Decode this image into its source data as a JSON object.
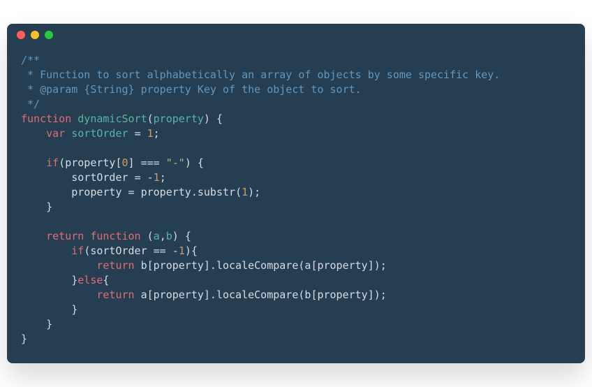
{
  "window": {
    "dots": [
      "red",
      "yellow",
      "green"
    ]
  },
  "code": {
    "tokens": [
      {
        "cls": "tok-comment",
        "text": "/**"
      },
      {
        "cls": "",
        "text": "\n"
      },
      {
        "cls": "tok-comment",
        "text": " * Function to sort alphabetically an array of objects by some specific key."
      },
      {
        "cls": "",
        "text": "\n"
      },
      {
        "cls": "tok-comment",
        "text": " * @param {String} property Key of the object to sort."
      },
      {
        "cls": "",
        "text": "\n"
      },
      {
        "cls": "tok-comment",
        "text": " */"
      },
      {
        "cls": "",
        "text": "\n"
      },
      {
        "cls": "tok-keyword",
        "text": "function"
      },
      {
        "cls": "",
        "text": " "
      },
      {
        "cls": "tok-funcname",
        "text": "dynamicSort"
      },
      {
        "cls": "tok-punct",
        "text": "("
      },
      {
        "cls": "tok-param",
        "text": "property"
      },
      {
        "cls": "tok-punct",
        "text": ")"
      },
      {
        "cls": "",
        "text": " "
      },
      {
        "cls": "tok-punct",
        "text": "{"
      },
      {
        "cls": "",
        "text": "\n    "
      },
      {
        "cls": "tok-keyword",
        "text": "var"
      },
      {
        "cls": "",
        "text": " "
      },
      {
        "cls": "tok-var",
        "text": "sortOrder"
      },
      {
        "cls": "",
        "text": " "
      },
      {
        "cls": "tok-op",
        "text": "="
      },
      {
        "cls": "",
        "text": " "
      },
      {
        "cls": "tok-num",
        "text": "1"
      },
      {
        "cls": "tok-punct",
        "text": ";"
      },
      {
        "cls": "",
        "text": "\n\n    "
      },
      {
        "cls": "tok-keyword",
        "text": "if"
      },
      {
        "cls": "tok-punct",
        "text": "("
      },
      {
        "cls": "tok-ident",
        "text": "property"
      },
      {
        "cls": "tok-punct",
        "text": "["
      },
      {
        "cls": "tok-num",
        "text": "0"
      },
      {
        "cls": "tok-punct",
        "text": "]"
      },
      {
        "cls": "",
        "text": " "
      },
      {
        "cls": "tok-op",
        "text": "==="
      },
      {
        "cls": "",
        "text": " "
      },
      {
        "cls": "tok-str",
        "text": "\"-\""
      },
      {
        "cls": "tok-punct",
        "text": ")"
      },
      {
        "cls": "",
        "text": " "
      },
      {
        "cls": "tok-punct",
        "text": "{"
      },
      {
        "cls": "",
        "text": "\n        "
      },
      {
        "cls": "tok-ident",
        "text": "sortOrder"
      },
      {
        "cls": "",
        "text": " "
      },
      {
        "cls": "tok-op",
        "text": "="
      },
      {
        "cls": "",
        "text": " "
      },
      {
        "cls": "tok-op",
        "text": "-"
      },
      {
        "cls": "tok-num",
        "text": "1"
      },
      {
        "cls": "tok-punct",
        "text": ";"
      },
      {
        "cls": "",
        "text": "\n        "
      },
      {
        "cls": "tok-ident",
        "text": "property"
      },
      {
        "cls": "",
        "text": " "
      },
      {
        "cls": "tok-op",
        "text": "="
      },
      {
        "cls": "",
        "text": " "
      },
      {
        "cls": "tok-ident",
        "text": "property"
      },
      {
        "cls": "tok-punct",
        "text": "."
      },
      {
        "cls": "tok-method",
        "text": "substr"
      },
      {
        "cls": "tok-punct",
        "text": "("
      },
      {
        "cls": "tok-num",
        "text": "1"
      },
      {
        "cls": "tok-punct",
        "text": ");"
      },
      {
        "cls": "",
        "text": "\n    "
      },
      {
        "cls": "tok-punct",
        "text": "}"
      },
      {
        "cls": "",
        "text": "\n\n    "
      },
      {
        "cls": "tok-keyword",
        "text": "return"
      },
      {
        "cls": "",
        "text": " "
      },
      {
        "cls": "tok-keyword",
        "text": "function"
      },
      {
        "cls": "",
        "text": " "
      },
      {
        "cls": "tok-punct",
        "text": "("
      },
      {
        "cls": "tok-param",
        "text": "a"
      },
      {
        "cls": "tok-punct",
        "text": ","
      },
      {
        "cls": "tok-param",
        "text": "b"
      },
      {
        "cls": "tok-punct",
        "text": ")"
      },
      {
        "cls": "",
        "text": " "
      },
      {
        "cls": "tok-punct",
        "text": "{"
      },
      {
        "cls": "",
        "text": "\n        "
      },
      {
        "cls": "tok-keyword",
        "text": "if"
      },
      {
        "cls": "tok-punct",
        "text": "("
      },
      {
        "cls": "tok-ident",
        "text": "sortOrder"
      },
      {
        "cls": "",
        "text": " "
      },
      {
        "cls": "tok-op",
        "text": "=="
      },
      {
        "cls": "",
        "text": " "
      },
      {
        "cls": "tok-op",
        "text": "-"
      },
      {
        "cls": "tok-num",
        "text": "1"
      },
      {
        "cls": "tok-punct",
        "text": "){"
      },
      {
        "cls": "",
        "text": "\n            "
      },
      {
        "cls": "tok-keyword",
        "text": "return"
      },
      {
        "cls": "",
        "text": " "
      },
      {
        "cls": "tok-ident",
        "text": "b"
      },
      {
        "cls": "tok-punct",
        "text": "["
      },
      {
        "cls": "tok-ident",
        "text": "property"
      },
      {
        "cls": "tok-punct",
        "text": "]."
      },
      {
        "cls": "tok-method",
        "text": "localeCompare"
      },
      {
        "cls": "tok-punct",
        "text": "("
      },
      {
        "cls": "tok-ident",
        "text": "a"
      },
      {
        "cls": "tok-punct",
        "text": "["
      },
      {
        "cls": "tok-ident",
        "text": "property"
      },
      {
        "cls": "tok-punct",
        "text": "]);"
      },
      {
        "cls": "",
        "text": "\n        "
      },
      {
        "cls": "tok-punct",
        "text": "}"
      },
      {
        "cls": "tok-keyword",
        "text": "else"
      },
      {
        "cls": "tok-punct",
        "text": "{"
      },
      {
        "cls": "",
        "text": "\n            "
      },
      {
        "cls": "tok-keyword",
        "text": "return"
      },
      {
        "cls": "",
        "text": " "
      },
      {
        "cls": "tok-ident",
        "text": "a"
      },
      {
        "cls": "tok-punct",
        "text": "["
      },
      {
        "cls": "tok-ident",
        "text": "property"
      },
      {
        "cls": "tok-punct",
        "text": "]."
      },
      {
        "cls": "tok-method",
        "text": "localeCompare"
      },
      {
        "cls": "tok-punct",
        "text": "("
      },
      {
        "cls": "tok-ident",
        "text": "b"
      },
      {
        "cls": "tok-punct",
        "text": "["
      },
      {
        "cls": "tok-ident",
        "text": "property"
      },
      {
        "cls": "tok-punct",
        "text": "]);"
      },
      {
        "cls": "",
        "text": "\n        "
      },
      {
        "cls": "tok-punct",
        "text": "}"
      },
      {
        "cls": "",
        "text": "\n    "
      },
      {
        "cls": "tok-punct",
        "text": "}"
      },
      {
        "cls": "",
        "text": "\n"
      },
      {
        "cls": "tok-punct",
        "text": "}"
      }
    ]
  }
}
